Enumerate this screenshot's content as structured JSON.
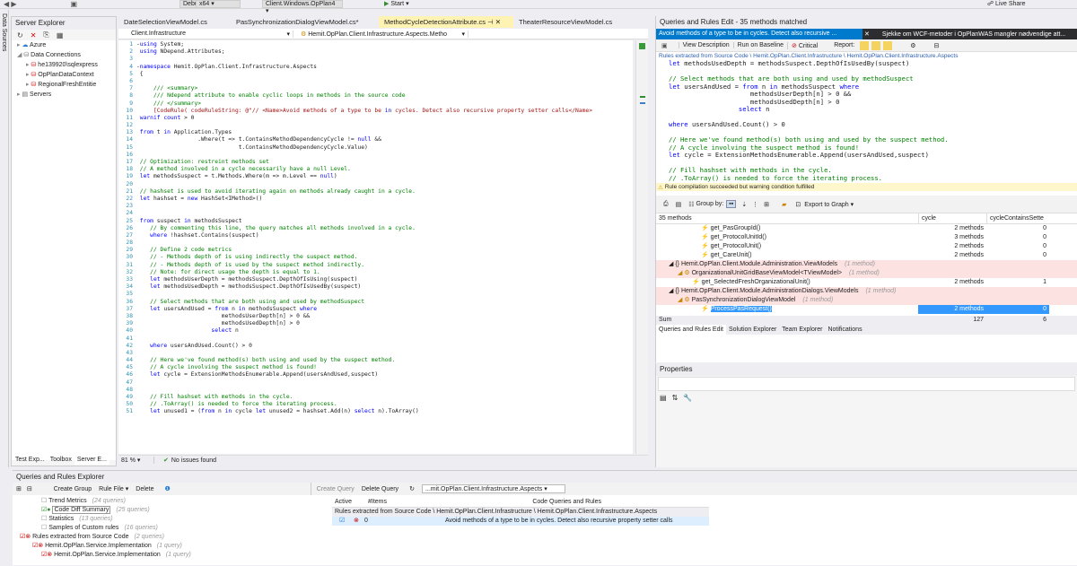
{
  "toolbar": {
    "config": "Debug",
    "platform": "x64",
    "project": "Client.Windows.OpPlan4",
    "start": "Start",
    "live_share": "Live Share"
  },
  "left_strip": {
    "label": "Data Sources"
  },
  "server_explorer": {
    "title": "Server Explorer",
    "items": [
      "Azure",
      "Data Connections",
      "he139920\\sqlexpress",
      "OpPlanDataContext",
      "RegionalFreshEntitie",
      "Servers"
    ],
    "tabs": [
      "Test Exp...",
      "Toolbox",
      "Server E..."
    ]
  },
  "editor": {
    "tabs": [
      "DateSelectionViewModel.cs",
      "PasSynchronizationDialogViewModel.cs*",
      "MethodCycleDetectionAttribute.cs",
      "TheaterResourceViewModel.cs"
    ],
    "active_tab": 2,
    "nav_left": "Client.Infrastructure",
    "nav_right": "Hemit.OpPlan.Client.Infrastructure.Aspects.Metho",
    "zoom": "81 %",
    "status": "No issues found",
    "lines": [
      {
        "n": "1",
        "t": "-using System;"
      },
      {
        "n": "2",
        "t": " using NDepend.Attributes;"
      },
      {
        "n": "3",
        "t": ""
      },
      {
        "n": "4",
        "t": "-namespace Hemit.OpPlan.Client.Infrastructure.Aspects"
      },
      {
        "n": "5",
        "t": " {"
      },
      {
        "n": "6",
        "t": ""
      },
      {
        "n": "7",
        "t": "     /// <summary>"
      },
      {
        "n": "8",
        "t": "     /// Ndepend attribute to enable cyclic loops in methods in the source code"
      },
      {
        "n": "9",
        "t": "     /// </summary>"
      },
      {
        "n": "10",
        "t": "     [CodeRule( codeRuleString: @\"// <Name>Avoid methods of a type to be in cycles. Detect also recursive property setter calls</Name>"
      },
      {
        "n": "11",
        "t": " warnif count > 0"
      },
      {
        "n": "12",
        "t": ""
      },
      {
        "n": "13",
        "t": " from t in Application.Types"
      },
      {
        "n": "14",
        "t": "                  .Where(t => t.ContainsMethodDependencyCycle != null &&"
      },
      {
        "n": "15",
        "t": "                              t.ContainsMethodDependencyCycle.Value)"
      },
      {
        "n": "16",
        "t": ""
      },
      {
        "n": "17",
        "t": " // Optimization: restreint methods set"
      },
      {
        "n": "18",
        "t": " // A method involved in a cycle necessarily have a null Level."
      },
      {
        "n": "19",
        "t": " let methodsSuspect = t.Methods.Where(m => m.Level == null)"
      },
      {
        "n": "20",
        "t": ""
      },
      {
        "n": "21",
        "t": " // hashset is used to avoid iterating again on methods already caught in a cycle."
      },
      {
        "n": "22",
        "t": " let hashset = new HashSet<IMethod>()"
      },
      {
        "n": "23",
        "t": ""
      },
      {
        "n": "24",
        "t": ""
      },
      {
        "n": "25",
        "t": " from suspect in methodsSuspect"
      },
      {
        "n": "26",
        "t": "    // By commenting this line, the query matches all methods involved in a cycle."
      },
      {
        "n": "27",
        "t": "    where !hashset.Contains(suspect)"
      },
      {
        "n": "28",
        "t": ""
      },
      {
        "n": "29",
        "t": "    // Define 2 code metrics"
      },
      {
        "n": "30",
        "t": "    // - Methods depth of is using indirectly the suspect method."
      },
      {
        "n": "31",
        "t": "    // - Methods depth of is used by the suspect method indirectly."
      },
      {
        "n": "32",
        "t": "    // Note: for direct usage the depth is equal to 1."
      },
      {
        "n": "33",
        "t": "    let methodsUserDepth = methodsSuspect.DepthOfIsUsing(suspect)"
      },
      {
        "n": "34",
        "t": "    let methodsUsedDepth = methodsSuspect.DepthOfIsUsedBy(suspect)"
      },
      {
        "n": "35",
        "t": ""
      },
      {
        "n": "36",
        "t": "    // Select methods that are both using and used by methodSuspect"
      },
      {
        "n": "37",
        "t": "    let usersAndUsed = from n in methodsSuspect where"
      },
      {
        "n": "38",
        "t": "                         methodsUserDepth[n] > 0 &&"
      },
      {
        "n": "39",
        "t": "                         methodsUsedDepth[n] > 0"
      },
      {
        "n": "40",
        "t": "                      select n"
      },
      {
        "n": "41",
        "t": ""
      },
      {
        "n": "42",
        "t": "    where usersAndUsed.Count() > 0"
      },
      {
        "n": "43",
        "t": ""
      },
      {
        "n": "44",
        "t": "    // Here we've found method(s) both using and used by the suspect method."
      },
      {
        "n": "45",
        "t": "    // A cycle involving the suspect method is found!"
      },
      {
        "n": "46",
        "t": "    let cycle = ExtensionMethodsEnumerable.Append(usersAndUsed,suspect)"
      },
      {
        "n": "47",
        "t": ""
      },
      {
        "n": "48",
        "t": ""
      },
      {
        "n": "49",
        "t": "    // Fill hashset with methods in the cycle."
      },
      {
        "n": "50",
        "t": "    // .ToArray() is needed to force the iterating process."
      },
      {
        "n": "51",
        "t": "    let unused1 = (from n in cycle let unused2 = hashset.Add(n) select n).ToArray()"
      }
    ]
  },
  "query_panel": {
    "title": "Queries and Rules Edit  - 35 methods matched",
    "rule_title": "Avoid methods of a type to be in cycles. Detect also recursive ...",
    "doc_tab": "Sjekke om WCF-metoder i OpPlanWAS mangler nødvendige att...",
    "buttons": [
      "View Description",
      "Run on Baseline",
      "Critical",
      "Report:"
    ],
    "breadcrumb": "Rules extracted from Source Code \\ Hemit.OpPlan.Client.Infrastructure \\ Hemit.OpPlan.Client.Infrastructure.Aspects",
    "code": [
      "let methodsUsedDepth = methodsSuspect.DepthOfIsUsedBy(suspect)",
      "",
      "// Select methods that are both using and used by methodSuspect",
      "let usersAndUsed = from n in methodsSuspect where",
      "                     methodsUserDepth[n] > 0 &&",
      "                     methodsUsedDepth[n] > 0",
      "                  select n",
      "",
      "where usersAndUsed.Count() > 0",
      "",
      "// Here we've found method(s) both using and used by the suspect method.",
      "// A cycle involving the suspect method is found!",
      "let cycle = ExtensionMethodsEnumerable.Append(usersAndUsed,suspect)",
      "",
      "// Fill hashset with methods in the cycle.",
      "// .ToArray() is needed to force the iterating process."
    ],
    "compile_msg": "Rule compilation succeeded but warning condition fulfilled",
    "group_by": "Group by:",
    "export": "Export to Graph",
    "col_methods": "35 methods",
    "col_cycle": "cycle",
    "col_contains": "cycleContainsSette",
    "results": [
      {
        "indent": 50,
        "label": "get_PasGroupId()",
        "cycle": "2 methods",
        "c": "0",
        "kind": "method"
      },
      {
        "indent": 50,
        "label": "get_ProtocolUnitId()",
        "cycle": "3 methods",
        "c": "0",
        "kind": "method"
      },
      {
        "indent": 50,
        "label": "get_ProtocolUnit()",
        "cycle": "2 methods",
        "c": "0",
        "kind": "method"
      },
      {
        "indent": 50,
        "label": "get_CareUnit()",
        "cycle": "2 methods",
        "c": "0",
        "kind": "method"
      },
      {
        "indent": 14,
        "label": "Hemit.OpPlan.Client.Module.Administration.ViewModels",
        "sub": "(1 method)",
        "cycle": "",
        "c": "",
        "kind": "ns"
      },
      {
        "indent": 24,
        "label": "OrganizationalUnitGridBaseViewModel<TViewModel>",
        "sub": "(1 method)",
        "cycle": "",
        "c": "",
        "kind": "type"
      },
      {
        "indent": 40,
        "label": "get_SelectedFreshOrganizationalUnit()",
        "cycle": "2 methods",
        "c": "1",
        "kind": "method"
      },
      {
        "indent": 14,
        "label": "Hemit.OpPlan.Client.Module.AdministrationDialogs.ViewModels",
        "sub": "(1 method)",
        "cycle": "",
        "c": "",
        "kind": "ns"
      },
      {
        "indent": 24,
        "label": "PasSynchronizationDialogViewModel",
        "sub": "(1 method)",
        "cycle": "",
        "c": "",
        "kind": "type"
      },
      {
        "indent": 50,
        "label": "ProcessPasRequest()",
        "cycle": "2 methods",
        "c": "0",
        "kind": "method",
        "selected": true
      }
    ],
    "sum_label": "Sum",
    "sum_cycle": "127",
    "sum_c": "6",
    "bottom_tabs": [
      "Queries and Rules Edit",
      "Solution Explorer",
      "Team Explorer",
      "Notifications"
    ]
  },
  "properties": {
    "title": "Properties"
  },
  "explorer": {
    "title": "Queries and Rules Explorer",
    "buttons": [
      "Create Group",
      "Rule File",
      "Delete"
    ],
    "tree": [
      {
        "label": "Trend Metrics",
        "sub": "(24 queries)",
        "indent": 30
      },
      {
        "label": "Code Diff Summary",
        "sub": "(25 queries)",
        "indent": 30,
        "boxed": true
      },
      {
        "label": "Statistics",
        "sub": "(13 queries)",
        "indent": 30
      },
      {
        "label": "Samples of Custom rules",
        "sub": "(16 queries)",
        "indent": 30
      },
      {
        "label": "Rules extracted from Source Code",
        "sub": "(2 queries)",
        "indent": 6
      },
      {
        "label": "Hemit.OpPlan.Service.Implementation",
        "sub": "(1 query)",
        "indent": 20
      },
      {
        "label": "Hemit.OpPlan.Service.Implementation",
        "sub": "(1 query)",
        "indent": 30
      }
    ],
    "right_buttons": [
      "Create Query",
      "Delete Query"
    ],
    "filter": "...mit.OpPlan.Client.Infrastructure.Aspects",
    "cols": [
      "Active",
      "#Items",
      "Code Queries and Rules"
    ],
    "group_row": "Rules extracted from Source Code \\ Hemit.OpPlan.Client.Infrastructure \\ Hemit.OpPlan.Client.Infrastructure.Aspects",
    "rule_items": "0",
    "rule_text": "Avoid methods of a type to be in cycles. Detect also recursive property setter calls"
  }
}
